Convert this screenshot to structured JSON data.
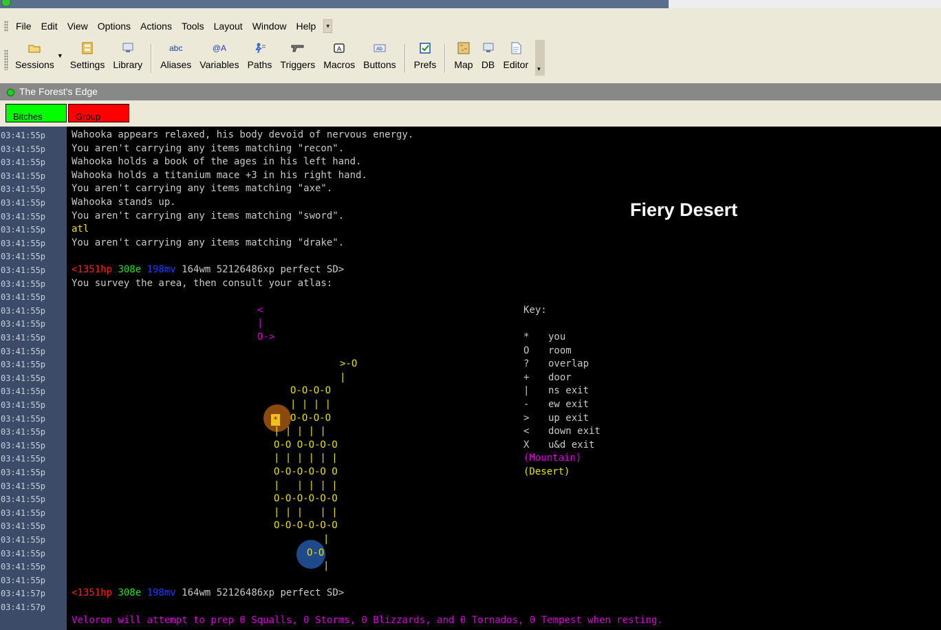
{
  "menu": [
    "File",
    "Edit",
    "View",
    "Options",
    "Actions",
    "Tools",
    "Layout",
    "Window",
    "Help"
  ],
  "toolbar": [
    {
      "label": "Sessions",
      "icon": "folder-icon"
    },
    {
      "label": "Settings",
      "icon": "settings-icon"
    },
    {
      "label": "Library",
      "icon": "library-icon"
    },
    {
      "label": "Aliases",
      "icon": "aliases-icon",
      "glyph": "abc"
    },
    {
      "label": "Variables",
      "icon": "variables-icon",
      "glyph": "@A"
    },
    {
      "label": "Paths",
      "icon": "paths-icon"
    },
    {
      "label": "Triggers",
      "icon": "triggers-icon"
    },
    {
      "label": "Macros",
      "icon": "macros-icon"
    },
    {
      "label": "Buttons",
      "icon": "buttons-icon"
    },
    {
      "label": "Prefs",
      "icon": "prefs-icon"
    },
    {
      "label": "Map",
      "icon": "map-icon"
    },
    {
      "label": "DB",
      "icon": "db-icon"
    },
    {
      "label": "Editor",
      "icon": "editor-icon"
    }
  ],
  "session": {
    "name": "The Forest's Edge",
    "status_color": "#1bd31b"
  },
  "user_buttons": [
    {
      "label": "Bitches",
      "color": "#00ff00"
    },
    {
      "label": "Group",
      "color": "#ff0000"
    }
  ],
  "area_title": "Fiery Desert",
  "timestamps": [
    "03:41:55p",
    "03:41:55p",
    "03:41:55p",
    "03:41:55p",
    "03:41:55p",
    "03:41:55p",
    "03:41:55p",
    "03:41:55p",
    "03:41:55p",
    "03:41:55p",
    "03:41:55p",
    "03:41:55p",
    "03:41:55p",
    "03:41:55p",
    "03:41:55p",
    "03:41:55p",
    "03:41:55p",
    "03:41:55p",
    "03:41:55p",
    "03:41:55p",
    "03:41:55p",
    "03:41:55p",
    "03:41:55p",
    "03:41:55p",
    "03:41:55p",
    "03:41:55p",
    "03:41:55p",
    "03:41:55p",
    "03:41:55p",
    "03:41:55p",
    "03:41:55p",
    "03:41:55p",
    "03:41:55p",
    "03:41:55p",
    "03:41:57p",
    "03:41:57p"
  ],
  "log": [
    "Wahooka appears relaxed, his body devoid of nervous energy.",
    "You aren't carrying any items matching \"recon\".",
    "Wahooka holds a book of the ages in his left hand.",
    "Wahooka holds a titanium mace +3 in his right hand.",
    "You aren't carrying any items matching \"axe\".",
    "Wahooka stands up.",
    "You aren't carrying any items matching \"sword\".",
    "atl",
    "You aren't carrying any items matching \"drake\".",
    "",
    "prompt",
    "You survey the area, then consult your atlas:"
  ],
  "prompt": {
    "hp": "<1351hp",
    "e": "308e",
    "mv": "198mv",
    "rest": "164wm 52126486xp perfect SD>"
  },
  "map_lines": [
    {
      "row": 13,
      "col": 374,
      "text": "<",
      "color": "mag"
    },
    {
      "row": 14,
      "col": 374,
      "text": "|",
      "color": "mag"
    },
    {
      "row": 15,
      "col": 374,
      "text": "O->",
      "color": "mag"
    },
    {
      "row": 17,
      "col": 494,
      "text": ">-O",
      "color": "yel"
    },
    {
      "row": 18,
      "col": 494,
      "text": "|",
      "color": "yel"
    },
    {
      "row": 19,
      "col": 422,
      "text": "O-O-O-O",
      "color": "yel"
    },
    {
      "row": 20,
      "col": 422,
      "text": "| | | |",
      "color": "yel"
    },
    {
      "row": 21,
      "col": 422,
      "text": "O-O-O-O",
      "color": "yel"
    },
    {
      "row": 22,
      "col": 398,
      "text": "| | | | |",
      "color": "yel"
    },
    {
      "row": 23,
      "col": 398,
      "text": "O-O O-O-O-O",
      "color": "yel"
    },
    {
      "row": 24,
      "col": 398,
      "text": "| | | | | |",
      "color": "yel"
    },
    {
      "row": 25,
      "col": 398,
      "text": "O-O-O-O-O O",
      "color": "yel"
    },
    {
      "row": 26,
      "col": 398,
      "text": "|   | | | |",
      "color": "yel"
    },
    {
      "row": 27,
      "col": 398,
      "text": "O-O-O-O-O-O",
      "color": "yel"
    },
    {
      "row": 28,
      "col": 398,
      "text": "| | |   | |",
      "color": "yel"
    },
    {
      "row": 29,
      "col": 398,
      "text": "O-O-O-O-O-O",
      "color": "yel"
    },
    {
      "row": 30,
      "col": 470,
      "text": "|",
      "color": "yel"
    },
    {
      "row": 31,
      "col": 446,
      "text": "O-O",
      "color": "yel"
    },
    {
      "row": 32,
      "col": 470,
      "text": "|",
      "color": "wht"
    }
  ],
  "key": {
    "title": "Key:",
    "entries": [
      {
        "sym": "*",
        "desc": "you"
      },
      {
        "sym": "O",
        "desc": "room"
      },
      {
        "sym": "?",
        "desc": "overlap"
      },
      {
        "sym": "+",
        "desc": "door"
      },
      {
        "sym": "|",
        "desc": "ns exit"
      },
      {
        "sym": "-",
        "desc": "ew exit"
      },
      {
        "sym": ">",
        "desc": "up exit"
      },
      {
        "sym": "<",
        "desc": "down exit"
      },
      {
        "sym": "X",
        "desc": "u&d exit"
      }
    ],
    "terrain": [
      {
        "label": "(Mountain)",
        "color": "mag"
      },
      {
        "label": "(Desert)",
        "color": "yel"
      }
    ]
  },
  "final_line": "Veloron will attempt to prep 0 Squalls, 0 Storms, 0 Blizzards, and 0 Tornados, 0 Tempest when resting."
}
